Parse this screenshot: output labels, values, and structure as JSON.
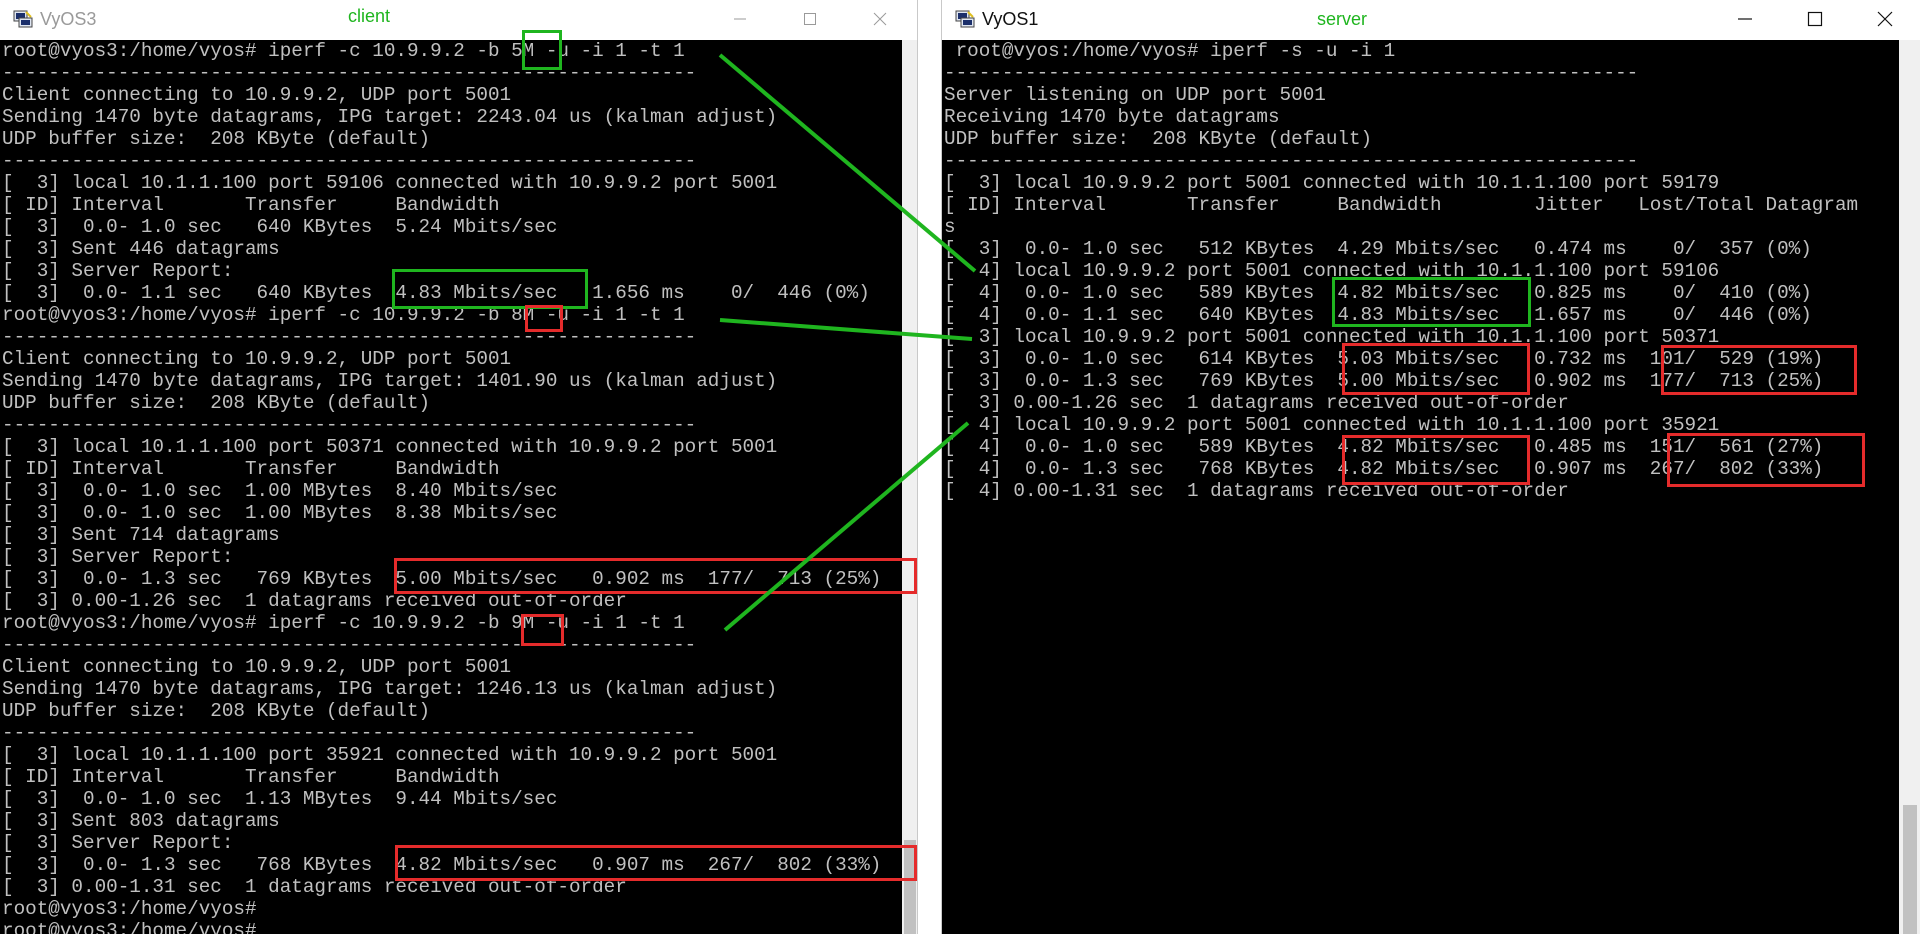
{
  "client_window": {
    "title": "VyOS3",
    "role_label": "client",
    "lines": [
      "root@vyos3:/home/vyos# iperf -c 10.9.9.2 -b 5M -u -i 1 -t 1",
      "------------------------------------------------------------",
      "Client connecting to 10.9.9.2, UDP port 5001",
      "Sending 1470 byte datagrams, IPG target: 2243.04 us (kalman adjust)",
      "UDP buffer size:  208 KByte (default)",
      "------------------------------------------------------------",
      "[  3] local 10.1.1.100 port 59106 connected with 10.9.9.2 port 5001",
      "[ ID] Interval       Transfer     Bandwidth",
      "[  3]  0.0- 1.0 sec   640 KBytes  5.24 Mbits/sec",
      "[  3] Sent 446 datagrams",
      "[  3] Server Report:",
      "[  3]  0.0- 1.1 sec   640 KBytes  4.83 Mbits/sec   1.656 ms    0/  446 (0%)",
      "root@vyos3:/home/vyos# iperf -c 10.9.9.2 -b 8M -u -i 1 -t 1",
      "------------------------------------------------------------",
      "Client connecting to 10.9.9.2, UDP port 5001",
      "Sending 1470 byte datagrams, IPG target: 1401.90 us (kalman adjust)",
      "UDP buffer size:  208 KByte (default)",
      "------------------------------------------------------------",
      "[  3] local 10.1.1.100 port 50371 connected with 10.9.9.2 port 5001",
      "[ ID] Interval       Transfer     Bandwidth",
      "[  3]  0.0- 1.0 sec  1.00 MBytes  8.40 Mbits/sec",
      "[  3]  0.0- 1.0 sec  1.00 MBytes  8.38 Mbits/sec",
      "[  3] Sent 714 datagrams",
      "[  3] Server Report:",
      "[  3]  0.0- 1.3 sec   769 KBytes  5.00 Mbits/sec   0.902 ms  177/  713 (25%)",
      "[  3] 0.00-1.26 sec  1 datagrams received out-of-order",
      "root@vyos3:/home/vyos# iperf -c 10.9.9.2 -b 9M -u -i 1 -t 1",
      "------------------------------------------------------------",
      "Client connecting to 10.9.9.2, UDP port 5001",
      "Sending 1470 byte datagrams, IPG target: 1246.13 us (kalman adjust)",
      "UDP buffer size:  208 KByte (default)",
      "------------------------------------------------------------",
      "[  3] local 10.1.1.100 port 35921 connected with 10.9.9.2 port 5001",
      "[ ID] Interval       Transfer     Bandwidth",
      "[  3]  0.0- 1.0 sec  1.13 MBytes  9.44 Mbits/sec",
      "[  3] Sent 803 datagrams",
      "[  3] Server Report:",
      "[  3]  0.0- 1.3 sec   768 KBytes  4.82 Mbits/sec   0.907 ms  267/  802 (33%)",
      "[  3] 0.00-1.31 sec  1 datagrams received out-of-order",
      "root@vyos3:/home/vyos# ",
      "root@vyos3:/home/vyos# "
    ]
  },
  "server_window": {
    "title": "VyOS1",
    "role_label": "server",
    "lines": [
      " root@vyos:/home/vyos# iperf -s -u -i 1",
      "------------------------------------------------------------",
      "Server listening on UDP port 5001",
      "Receiving 1470 byte datagrams",
      "UDP buffer size:  208 KByte (default)",
      "------------------------------------------------------------",
      "[  3] local 10.9.9.2 port 5001 connected with 10.1.1.100 port 59179",
      "[ ID] Interval       Transfer     Bandwidth        Jitter   Lost/Total Datagram",
      "s",
      "[  3]  0.0- 1.0 sec   512 KBytes  4.29 Mbits/sec   0.474 ms    0/  357 (0%)",
      "[  4] local 10.9.9.2 port 5001 connected with 10.1.1.100 port 59106",
      "[  4]  0.0- 1.0 sec   589 KBytes  4.82 Mbits/sec   0.825 ms    0/  410 (0%)",
      "[  4]  0.0- 1.1 sec   640 KBytes  4.83 Mbits/sec   1.657 ms    0/  446 (0%)",
      "[  3] local 10.9.9.2 port 5001 connected with 10.1.1.100 port 50371",
      "[  3]  0.0- 1.0 sec   614 KBytes  5.03 Mbits/sec   0.732 ms  101/  529 (19%)",
      "[  3]  0.0- 1.3 sec   769 KBytes  5.00 Mbits/sec   0.902 ms  177/  713 (25%)",
      "[  3] 0.00-1.26 sec  1 datagrams received out-of-order",
      "[  4] local 10.9.9.2 port 5001 connected with 10.1.1.100 port 35921",
      "[  4]  0.0- 1.0 sec   589 KBytes  4.82 Mbits/sec   0.485 ms  151/  561 (27%)",
      "[  4]  0.0- 1.3 sec   768 KBytes  4.82 Mbits/sec   0.907 ms  267/  802 (33%)",
      "[  4] 0.00-1.31 sec  1 datagrams received out-of-order"
    ]
  },
  "colors": {
    "highlight_green": "#1fb51f",
    "highlight_red": "#e52b2b",
    "terminal_bg": "#000000",
    "terminal_fg": "#c0c0c0"
  },
  "icons": {
    "app": "putty-icon",
    "minimize": "minimize-icon",
    "maximize": "maximize-icon",
    "close": "close-icon"
  }
}
